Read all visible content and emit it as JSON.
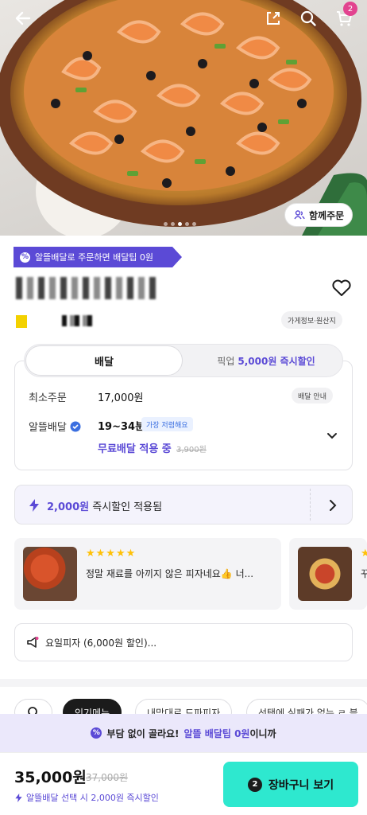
{
  "header": {
    "back_icon": "arrow-left-icon",
    "share_icon": "share-icon",
    "search_icon": "search-icon",
    "cart_icon": "cart-icon",
    "cart_count": "2"
  },
  "hero": {
    "carousel_total": 5,
    "carousel_active": 3,
    "together_order_label": "함께주문"
  },
  "promo_tag": {
    "label": "알뜰배달로 주문하면 배달팁 0원"
  },
  "store": {
    "info_label": "가게정보·원산지"
  },
  "order_type": {
    "tabs": [
      {
        "label": "배달",
        "active": true
      },
      {
        "label": "픽업",
        "active": false
      }
    ],
    "pickup_discount": "5,000원 즉시할인"
  },
  "delivery": {
    "min_order_label": "최소주문",
    "min_order_value": "17,000원",
    "delivery_guide_label": "배달 안내",
    "saver_label": "알뜰배달",
    "time_value": "19~34분",
    "cheapest_badge": "가장 저렴해요",
    "free_delivery": "무료배달 적용 중",
    "old_fee": "3,900원"
  },
  "discount_bar": {
    "amount": "2,000원",
    "text": "즉시할인 적용됨"
  },
  "reviews": [
    {
      "stars": "★★★★★",
      "text": "정말 재료를 아끼지 않은 피자네요👍 너..."
    },
    {
      "stars": "★",
      "text": "꾸"
    }
  ],
  "coupon": {
    "text": "요일피자 (6,000원 할인)..."
  },
  "categories": [
    {
      "label": "인기메뉴",
      "active": true
    },
    {
      "label": "내맘대로 드파피자",
      "active": false
    },
    {
      "label": "선택에 실패가 없는 ㄹ 블",
      "active": false
    }
  ],
  "overlay_promo": {
    "prefix": "부담 없이 골라요!",
    "highlight": "알뜰 배달팁 0원",
    "suffix": "이니까"
  },
  "bottom_bar": {
    "price": "35,000원",
    "old_price": "37,000원",
    "note": "알뜰배달 선택 시 2,000원 즉시할인",
    "cart_count": "2",
    "cart_button_label": "장바구니 보기"
  },
  "colors": {
    "brand_purple": "#5b4ad6",
    "mint_button": "#2ee8cf",
    "badge_pink": "#e2438f"
  }
}
